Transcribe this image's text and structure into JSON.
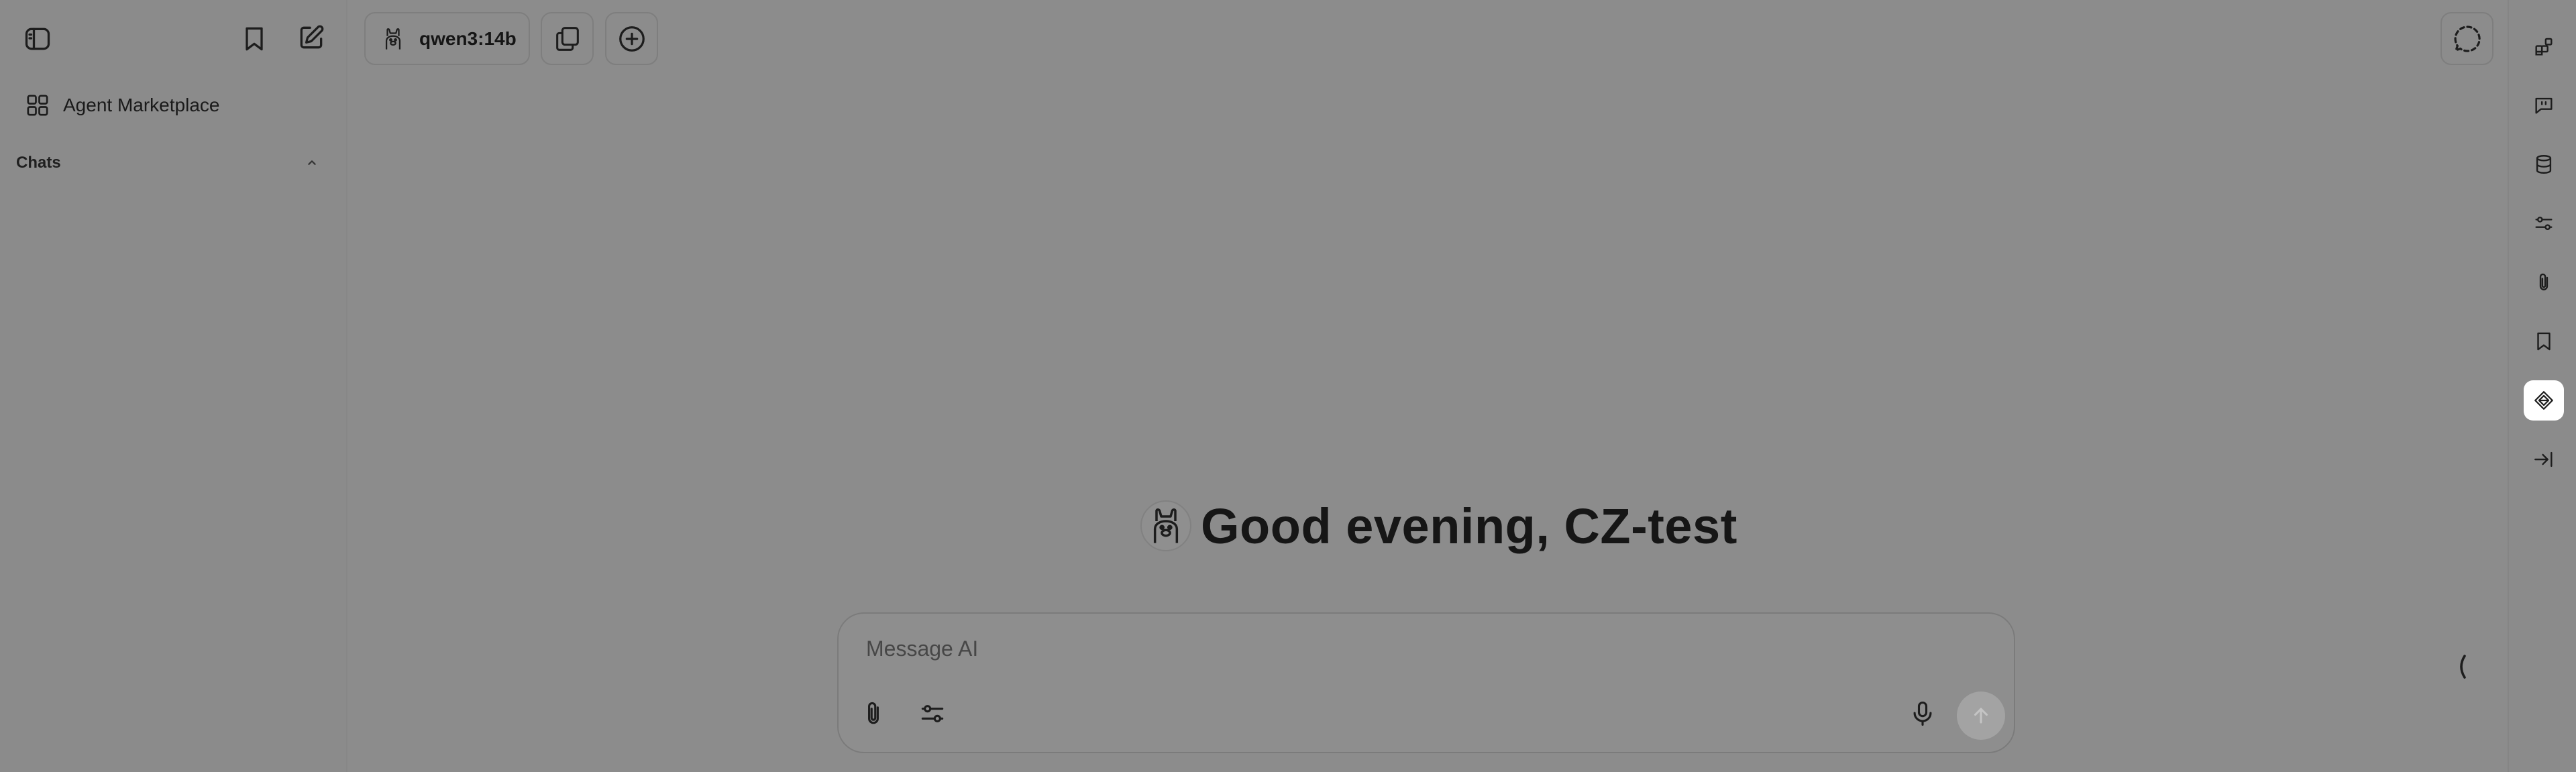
{
  "sidebar": {
    "marketplace_label": "Agent Marketplace",
    "chats_heading": "Chats"
  },
  "header": {
    "model_name": "qwen3:14b"
  },
  "main": {
    "greeting": "Good evening, CZ-test"
  },
  "composer": {
    "placeholder": "Message AI"
  },
  "icons": {
    "sidebar_toggle": "sidebar-toggle-icon",
    "bookmark": "bookmark-icon",
    "new_chat": "edit-icon",
    "marketplace": "grid-icon",
    "chevron": "chevron-up-icon",
    "model": "llama-icon",
    "copy": "copy-icon",
    "add": "plus-circle-icon",
    "attach": "paperclip-icon",
    "settings": "sliders-icon",
    "mic": "microphone-icon",
    "send": "arrow-up-icon"
  },
  "colors": {
    "overlay_background": "#8c8c8c",
    "active_rail_button": "#ffffff"
  }
}
